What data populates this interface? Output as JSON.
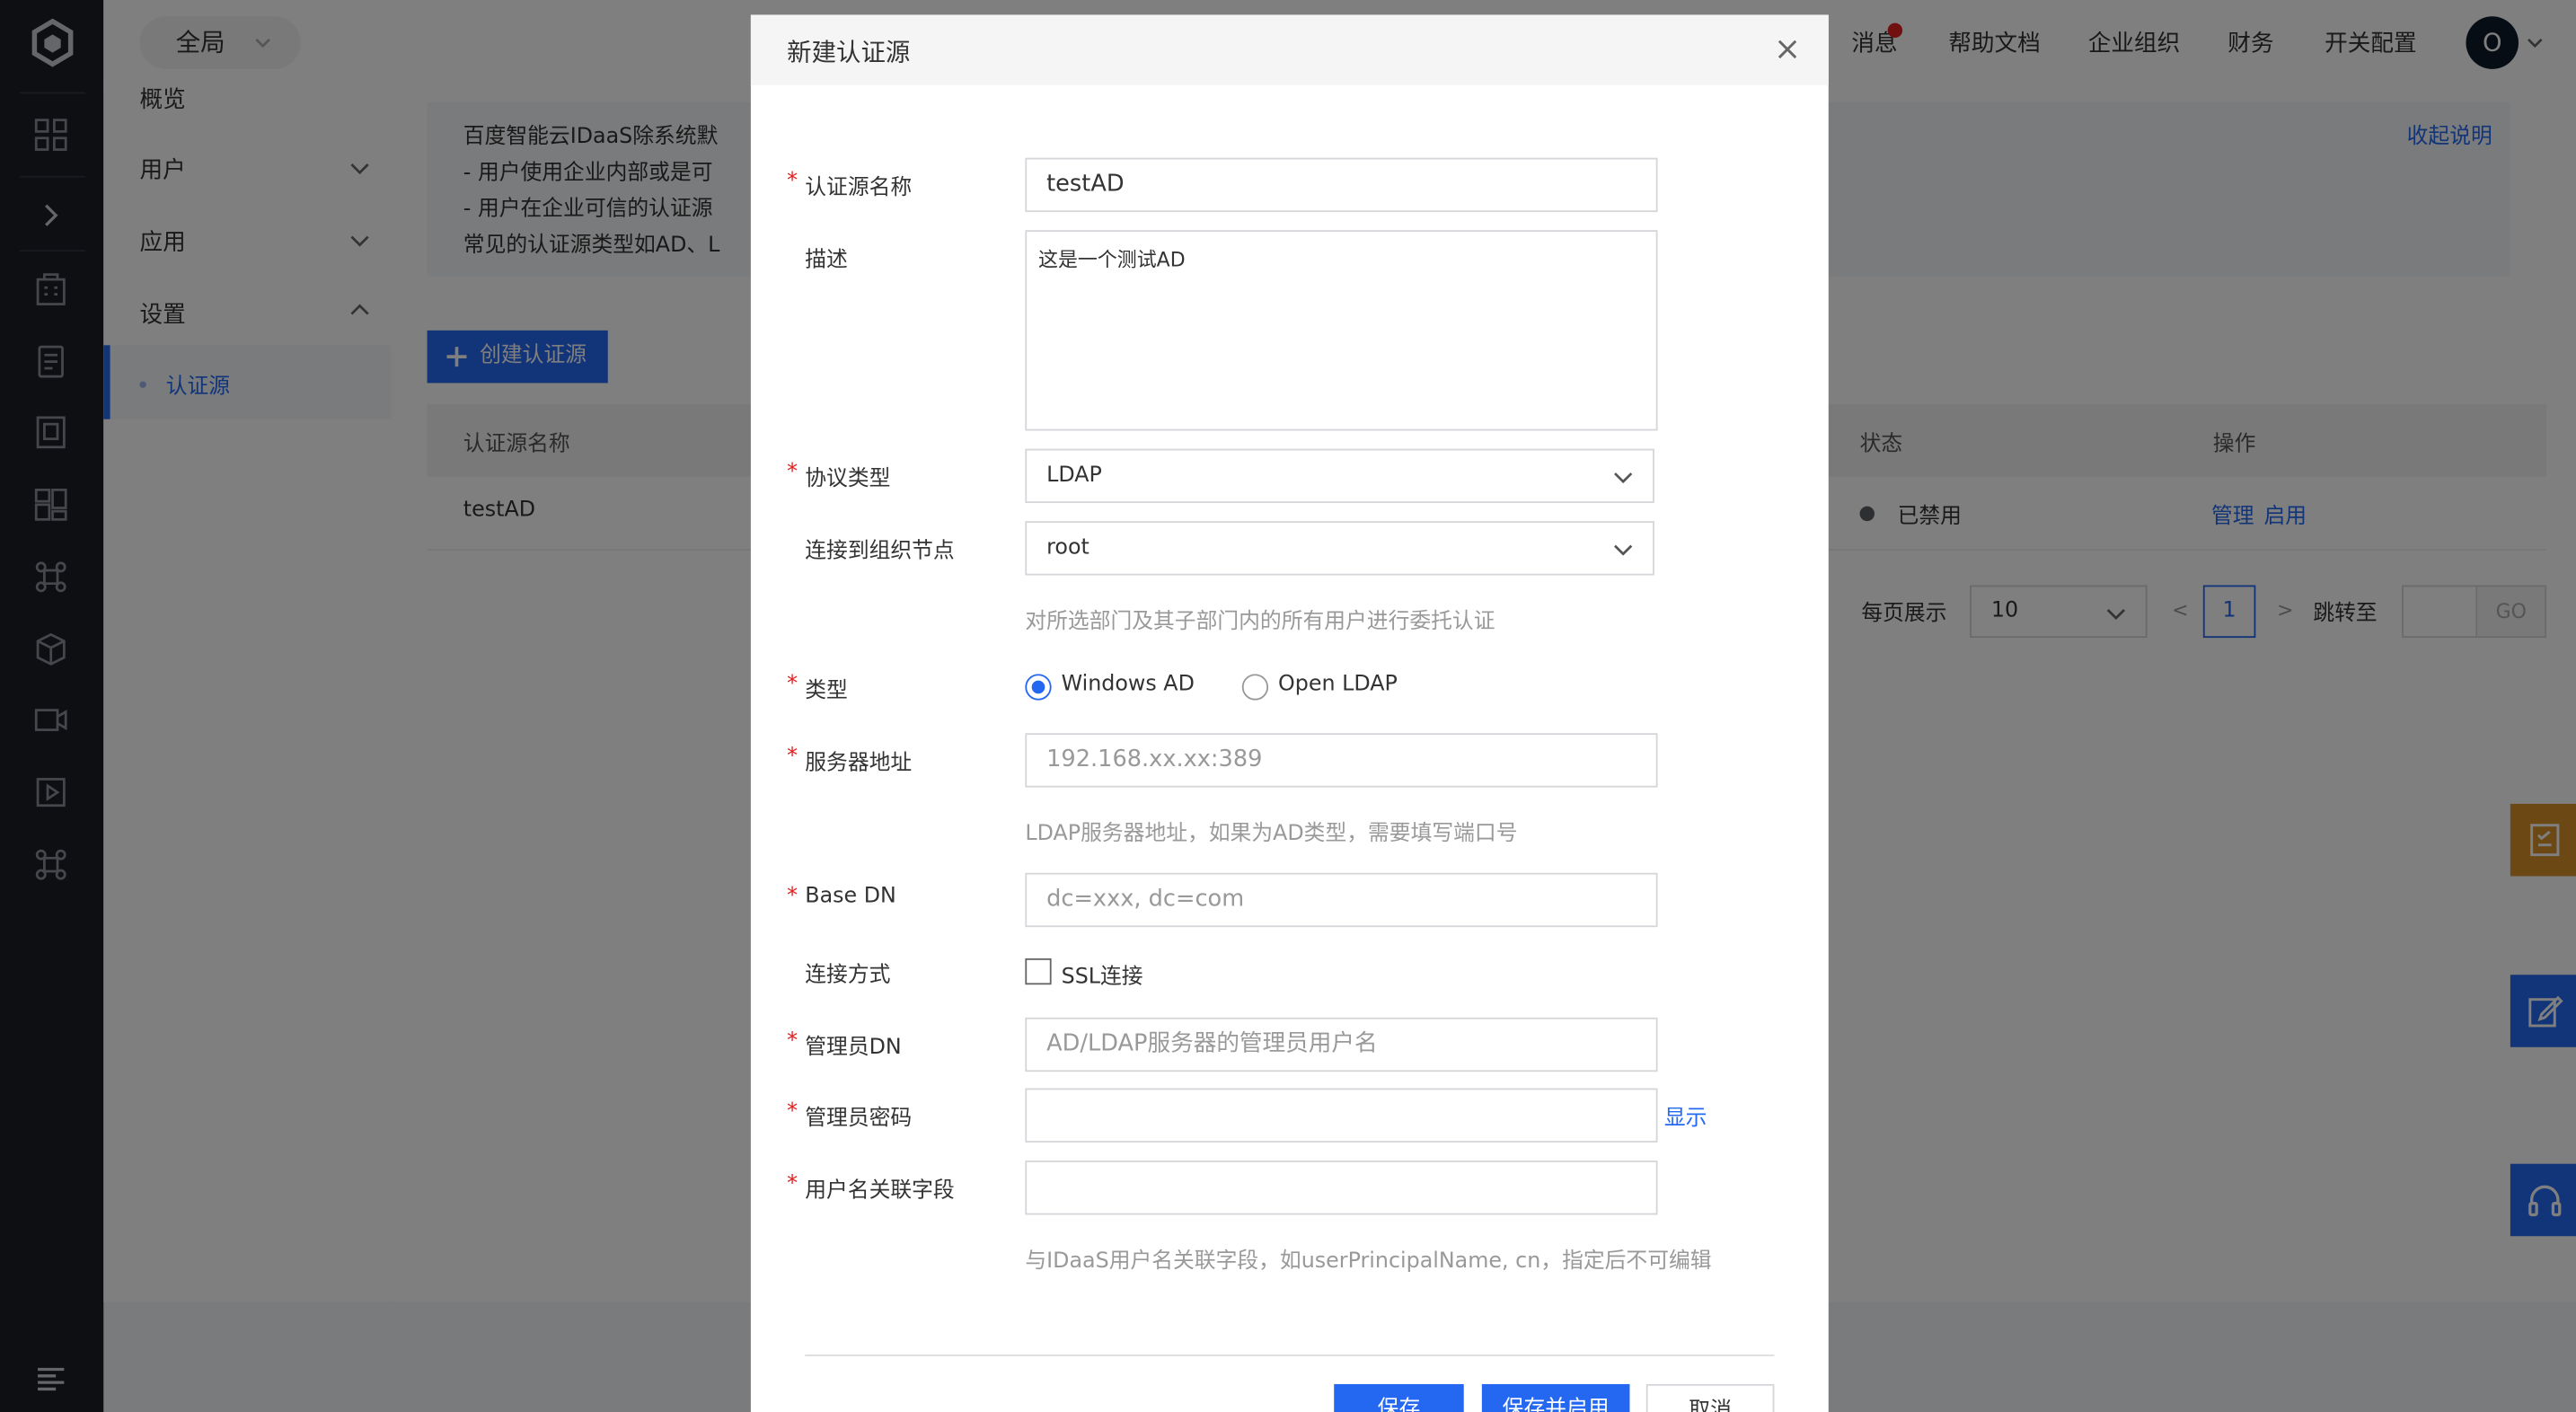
{
  "colors": {
    "accent": "#2468f2",
    "rail_bg": "#1d1f25",
    "required_star": "#e02020",
    "notification_dot": "#e02020",
    "status_disabled": "#5c5f66",
    "float_tools": "#d9902a"
  },
  "header": {
    "scope_label": "全局",
    "nav": [
      "消息",
      "帮助文档",
      "企业组织",
      "财务",
      "开关配置"
    ],
    "avatar_initial": "O"
  },
  "sidebar": {
    "overview": "概览",
    "users": "用户",
    "apps": "应用",
    "settings": "设置",
    "auth_source": "认证源"
  },
  "rail_icons": [
    "dashboard-icon",
    "expand-icon",
    "building-icon",
    "document-icon",
    "book-icon",
    "grid-icon",
    "command-icon",
    "package-icon",
    "video-icon",
    "play-icon",
    "command-icon",
    "menu-icon"
  ],
  "info": {
    "lines": [
      "百度智能云IDaaS除系统默",
      "- 用户使用企业内部或是可",
      "- 用户在企业可信的认证源",
      "常见的认证源类型如AD、L"
    ],
    "collapse": "收起说明"
  },
  "main": {
    "create_button": "创建认证源",
    "table": {
      "headers": [
        "认证源名称",
        "状态",
        "操作"
      ],
      "row": {
        "name": "testAD",
        "status": "已禁用",
        "action_manage": "管理",
        "action_enable": "启用"
      }
    },
    "pager": {
      "per_page_label": "每页展示",
      "per_page_value": "10",
      "prev": "<",
      "page": "1",
      "next": ">",
      "jump_label": "跳转至",
      "go": "GO"
    }
  },
  "float_tools": [
    "checklist-icon",
    "edit-icon",
    "headset-icon"
  ],
  "modal": {
    "title": "新建认证源",
    "fields": {
      "name": {
        "label": "认证源名称",
        "value": "testAD",
        "required": true
      },
      "description": {
        "label": "描述",
        "value": "这是一个测试AD"
      },
      "protocol": {
        "label": "协议类型",
        "value": "LDAP",
        "required": true
      },
      "org_node": {
        "label": "连接到组织节点",
        "value": "root",
        "hint": "对所选部门及其子部门内的所有用户进行委托认证"
      },
      "type": {
        "label": "类型",
        "required": true,
        "options": [
          "Windows AD",
          "Open LDAP"
        ],
        "selected": "Windows AD"
      },
      "server": {
        "label": "服务器地址",
        "placeholder": "192.168.xx.xx:389",
        "hint": "LDAP服务器地址，如果为AD类型，需要填写端口号",
        "required": true
      },
      "base_dn": {
        "label": "Base DN",
        "placeholder": "dc=xxx, dc=com",
        "required": true
      },
      "connection": {
        "label": "连接方式",
        "checkbox": "SSL连接",
        "checked": false
      },
      "admin_dn": {
        "label": "管理员DN",
        "placeholder": "AD/LDAP服务器的管理员用户名",
        "required": true
      },
      "admin_password": {
        "label": "管理员密码",
        "show": "显示",
        "required": true
      },
      "username_field": {
        "label": "用户名关联字段",
        "hint": "与IDaaS用户名关联字段，如userPrincipalName, cn，指定后不可编辑",
        "required": true
      }
    },
    "buttons": {
      "save": "保存",
      "save_enable": "保存并启用",
      "cancel": "取消"
    }
  }
}
